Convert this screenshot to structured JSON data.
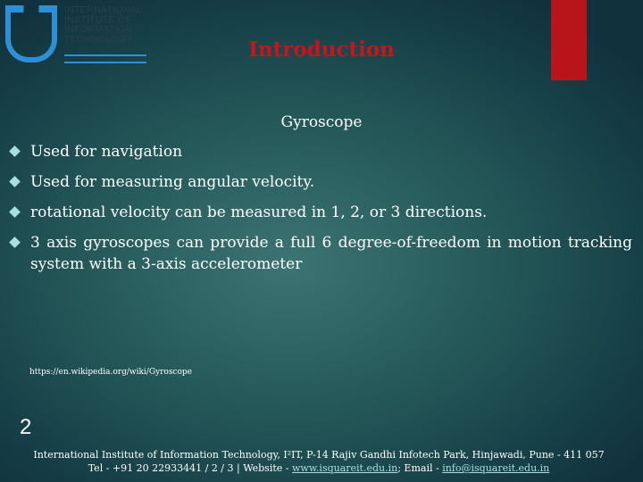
{
  "logo": {
    "mark": "I IT",
    "name_lines": [
      "INTERNATIONAL",
      "INSTITUTE OF",
      "INFORMATION",
      "TECHNOLOGY"
    ]
  },
  "colors": {
    "title": "#c8141a",
    "accent_bar": "#b8141a",
    "bullet": "#a9dfe0",
    "background": "#255959"
  },
  "slide": {
    "title": "Introduction",
    "subtitle": "Gyroscope",
    "bullets": [
      "Used for navigation",
      "Used for measuring angular velocity.",
      "rotational velocity can be measured in 1, 2, or 3 directions.",
      "3 axis gyroscopes can provide a full 6 degree-of-freedom in motion tracking system with a 3-axis accelerometer"
    ],
    "reference": "https://en.wikipedia.org/wiki/Gyroscope",
    "page_number": "2"
  },
  "footer": {
    "line1": "International Institute of Information Technology, I²IT, P-14 Rajiv Gandhi Infotech Park, Hinjawadi, Pune - 411 057",
    "tel": "Tel - +91 20 22933441 / 2 / 3  |  Website - ",
    "website": "www.isquareit.edu.in",
    "email_label": "; Email - ",
    "email": "info@isquareit.edu.in"
  }
}
